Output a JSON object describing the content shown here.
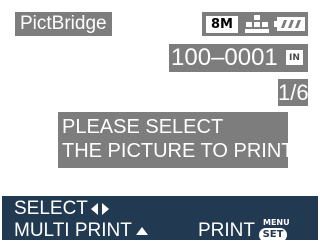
{
  "header": {
    "title": "PictBridge",
    "picture_size": "8M",
    "quality_icon": "quality-fine-icon",
    "battery_icon": "battery-full-icon"
  },
  "file": {
    "number": "100–0001",
    "card_label": "IN",
    "card_icon": "built-in-memory-icon"
  },
  "page_counter": "1/6",
  "message": {
    "line1": "PLEASE SELECT",
    "line2": "THE PICTURE TO PRINT"
  },
  "footer": {
    "select_label": "SELECT",
    "select_icon": "left-right-arrows-icon",
    "multi_print_label": "MULTI PRINT",
    "multi_print_icon": "up-arrow-icon",
    "print_label": "PRINT",
    "menu_label": "MENU",
    "set_label": "SET"
  },
  "colors": {
    "label_bg": "#7d7d7d",
    "footer_bg": "#213a52",
    "text": "#ffffff"
  }
}
